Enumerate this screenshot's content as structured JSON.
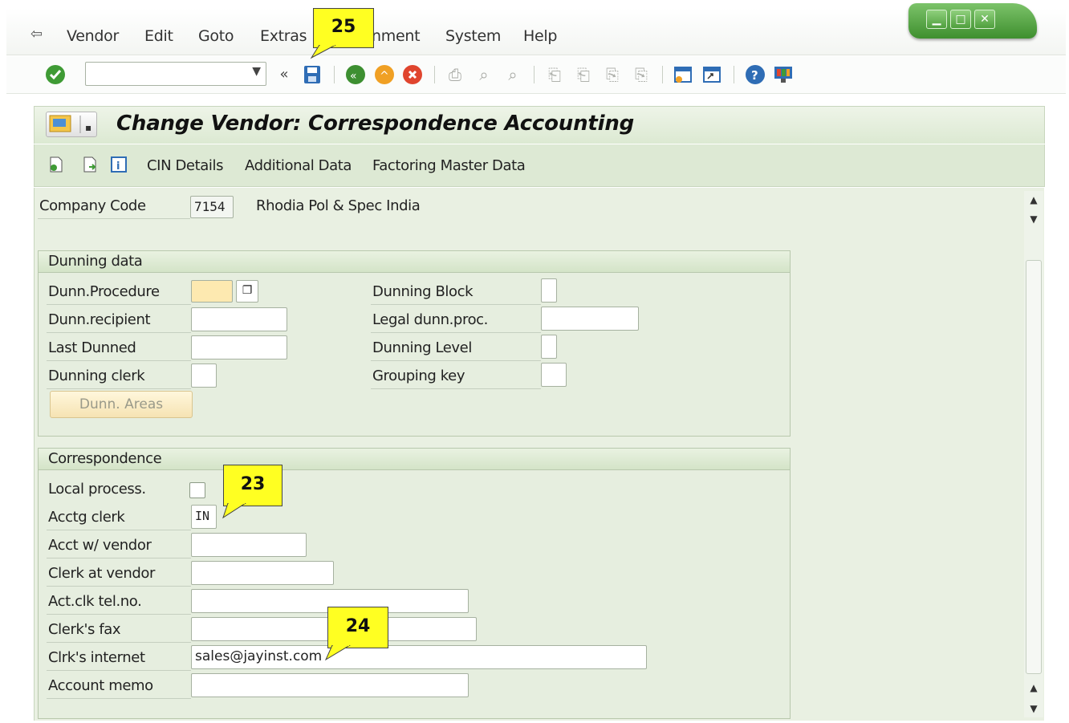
{
  "menu": {
    "items": [
      "Vendor",
      "Edit",
      "Goto",
      "Extras",
      "nment",
      "System",
      "Help"
    ]
  },
  "window_controls": [
    "▁",
    "□",
    "✕"
  ],
  "toolbar": {
    "command_value": "",
    "icons": [
      "enter-icon",
      "back-icon",
      "save-icon",
      "back-green-icon",
      "exit-icon",
      "cancel-icon",
      "print-icon",
      "find-icon",
      "find-next-icon",
      "first-page-icon",
      "previous-page-icon",
      "next-page-icon",
      "last-page-icon",
      "create-session-icon",
      "shortcut-icon",
      "help-icon",
      "customize-layout-icon"
    ]
  },
  "title": "Change Vendor: Correspondence Accounting",
  "app_toolbar": {
    "buttons": [
      "CIN Details",
      "Additional Data",
      "Factoring Master Data"
    ]
  },
  "header": {
    "company_code_label": "Company Code",
    "company_code_value": "7154",
    "company_name": "Rhodia Pol & Spec India"
  },
  "dunning": {
    "title": "Dunning data",
    "left_fields": [
      {
        "label": "Dunn.Procedure",
        "value": ""
      },
      {
        "label": "Dunn.recipient",
        "value": ""
      },
      {
        "label": "Last Dunned",
        "value": ""
      },
      {
        "label": "Dunning clerk",
        "value": ""
      }
    ],
    "right_fields": [
      {
        "label": "Dunning Block",
        "value": ""
      },
      {
        "label": "Legal dunn.proc.",
        "value": ""
      },
      {
        "label": "Dunning Level",
        "value": ""
      },
      {
        "label": "Grouping key",
        "value": ""
      }
    ],
    "areas_button": "Dunn. Areas"
  },
  "correspondence": {
    "title": "Correspondence",
    "local_process_label": "Local process.",
    "local_process_checked": false,
    "fields": [
      {
        "label": "Acctg clerk",
        "value": "IN"
      },
      {
        "label": "Acct w/ vendor",
        "value": ""
      },
      {
        "label": "Clerk at vendor",
        "value": ""
      },
      {
        "label": "Act.clk tel.no.",
        "value": ""
      },
      {
        "label": "Clerk's fax",
        "value": ""
      },
      {
        "label": "Clrk's internet",
        "value": "sales@jayinst.com"
      },
      {
        "label": "Account memo",
        "value": ""
      }
    ]
  },
  "callouts": [
    "25",
    "23",
    "24"
  ],
  "colors": {
    "callout": "#ffff22",
    "title_bg": "#dde9d4",
    "accent_green": "#3e8f2e"
  }
}
